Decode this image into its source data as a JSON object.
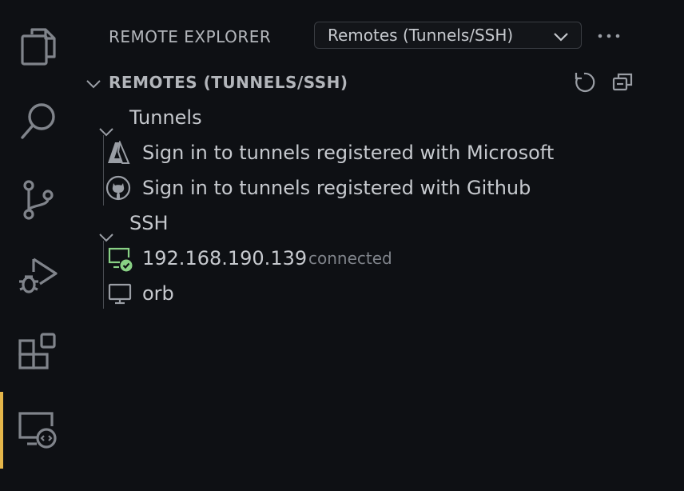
{
  "activity_bar": {
    "items": [
      {
        "name": "explorer-icon"
      },
      {
        "name": "search-icon"
      },
      {
        "name": "source-control-icon"
      },
      {
        "name": "run-debug-icon"
      },
      {
        "name": "extensions-icon"
      },
      {
        "name": "remote-explorer-icon",
        "active": true
      }
    ]
  },
  "sidebar": {
    "title": "REMOTE EXPLORER",
    "view_select": {
      "value": "Remotes (Tunnels/SSH)"
    },
    "more_icon": "ellipsis-icon",
    "section": {
      "title": "REMOTES (TUNNELS/SSH)",
      "actions": [
        "refresh-icon",
        "collapse-all-icon"
      ]
    },
    "tree": {
      "tunnels": {
        "label": "Tunnels",
        "items": [
          {
            "label": "Sign in to tunnels registered with Microsoft",
            "icon": "azure-icon"
          },
          {
            "label": "Sign in to tunnels registered with Github",
            "icon": "github-icon"
          }
        ]
      },
      "ssh": {
        "label": "SSH",
        "items": [
          {
            "label": "192.168.190.139",
            "description": "connected",
            "icon": "connected-monitor-icon"
          },
          {
            "label": "orb",
            "icon": "monitor-icon"
          }
        ]
      }
    }
  },
  "colors": {
    "background": "#0e1014",
    "active_indicator": "#e5b64a",
    "connected": "#89d185"
  }
}
